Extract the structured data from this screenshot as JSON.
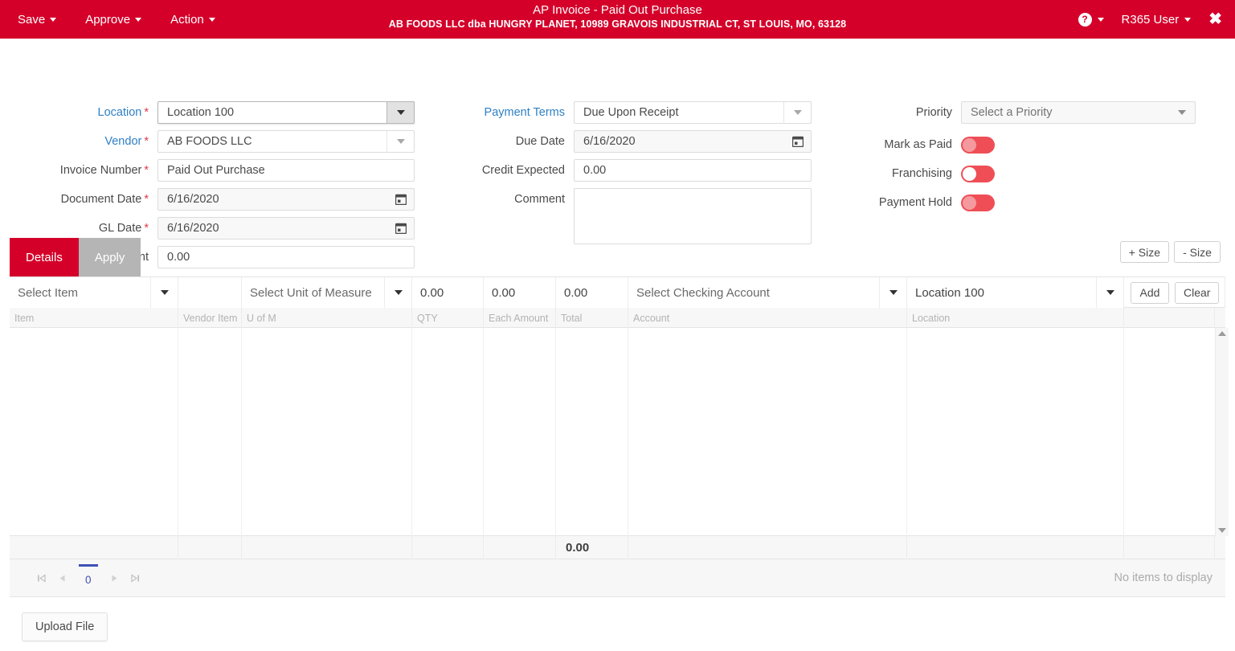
{
  "header": {
    "menus": [
      {
        "label": "Save",
        "name": "menu-save"
      },
      {
        "label": "Approve",
        "name": "menu-approve"
      },
      {
        "label": "Action",
        "name": "menu-action"
      }
    ],
    "title": "AP Invoice - Paid Out Purchase",
    "subtitle": "AB FOODS LLC dba HUNGRY PLANET, 10989 GRAVOIS INDUSTRIAL CT, ST LOUIS, MO, 63128",
    "help_icon": "question-circle-icon",
    "help_glyph": "?",
    "user": "R365 User",
    "close_glyph": "✖",
    "brand_red": "#d4002a"
  },
  "form": {
    "col1": [
      {
        "label": "Location",
        "required": true,
        "link": true,
        "value": "Location 100"
      },
      {
        "label": "Vendor",
        "required": true,
        "link": true,
        "value": "AB FOODS LLC"
      },
      {
        "label": "Invoice Number",
        "required": true,
        "link": false,
        "value": "Paid Out Purchase"
      },
      {
        "label": "Document Date",
        "required": true,
        "link": false,
        "value": "6/16/2020"
      },
      {
        "label": "GL Date",
        "required": true,
        "link": false,
        "value": "6/16/2020"
      },
      {
        "label": "Document Amount",
        "required": false,
        "link": false,
        "value": "0.00"
      }
    ],
    "col2": [
      {
        "label": "Payment Terms",
        "required": false,
        "link": true,
        "value": "Due Upon Receipt"
      },
      {
        "label": "Due Date",
        "required": false,
        "link": false,
        "value": "6/16/2020"
      },
      {
        "label": "Credit Expected",
        "required": false,
        "link": false,
        "value": "0.00"
      },
      {
        "label": "Comment",
        "required": false,
        "link": false,
        "value": ""
      }
    ],
    "col3": {
      "priority": {
        "label": "Priority",
        "value": "Select a Priority"
      },
      "toggles": [
        {
          "label": "Mark as Paid",
          "state": "off"
        },
        {
          "label": "Franchising",
          "state": "off"
        },
        {
          "label": "Payment Hold",
          "state": "off"
        }
      ]
    },
    "toggle_color": "#ef4e56"
  },
  "tabs": [
    {
      "label": "Details",
      "active": true
    },
    {
      "label": "Apply",
      "active": false
    }
  ],
  "size_buttons": [
    {
      "label": "+ Size"
    },
    {
      "label": "- Size"
    }
  ],
  "grid": {
    "entry_row": {
      "item": "Select Item",
      "vendor_item": "",
      "uom": "Select Unit of Measure",
      "qty": "0.00",
      "each_amount": "0.00",
      "total": "0.00",
      "account": "Select Checking Account",
      "location": "Location 100",
      "add_label": "Add",
      "clear_label": "Clear"
    },
    "columns": [
      "Item",
      "Vendor Item",
      "U of M",
      "QTY",
      "Each Amount",
      "Total",
      "Account",
      "Location",
      ""
    ],
    "rows": [],
    "totals": {
      "total": "0.00"
    },
    "empty_message": "No items to display",
    "pager": {
      "first": "⏮",
      "prev": "◀",
      "page": "0",
      "next": "▶",
      "last": "⏭"
    }
  },
  "footer": {
    "upload_label": "Upload File"
  }
}
